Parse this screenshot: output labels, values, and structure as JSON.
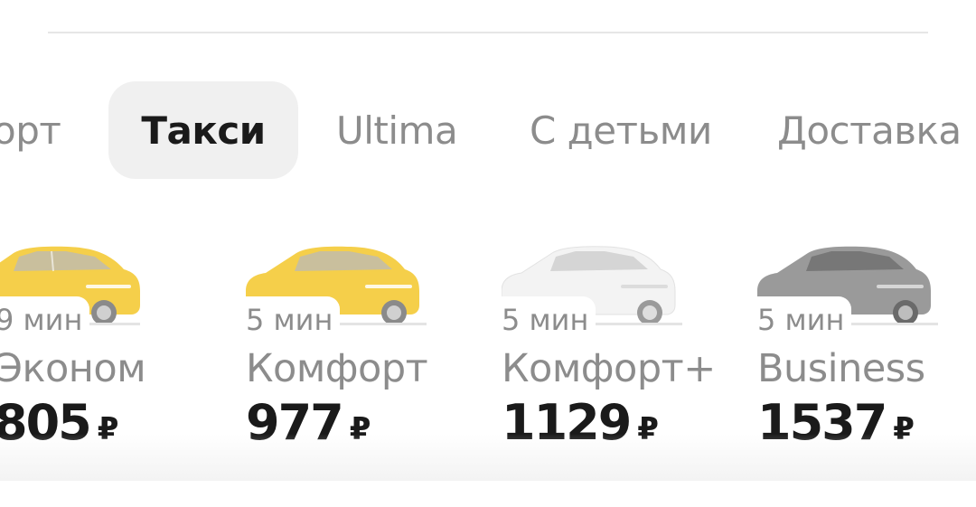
{
  "tabs": [
    {
      "label": "орт",
      "active": false
    },
    {
      "label": "Такси",
      "active": true
    },
    {
      "label": "Ultima",
      "active": false
    },
    {
      "label": "С детьми",
      "active": false
    },
    {
      "label": "Доставка",
      "active": false
    }
  ],
  "tariffs": [
    {
      "eta": "9 мин",
      "name": "Эконом",
      "price": "805",
      "currency": "₽",
      "car_color": "#f5cf4a",
      "car_icon": "yellow-sedan-icon"
    },
    {
      "eta": "5 мин",
      "name": "Комфорт",
      "price": "977",
      "currency": "₽",
      "car_color": "#f5cf4a",
      "car_icon": "yellow-sedan-icon"
    },
    {
      "eta": "5 мин",
      "name": "Комфорт+",
      "price": "1129",
      "currency": "₽",
      "car_color": "#f0f0f0",
      "car_icon": "white-sedan-icon"
    },
    {
      "eta": "5 мин",
      "name": "Business",
      "price": "1537",
      "currency": "₽",
      "car_color": "#9a9a9a",
      "car_icon": "grey-sedan-icon"
    }
  ]
}
